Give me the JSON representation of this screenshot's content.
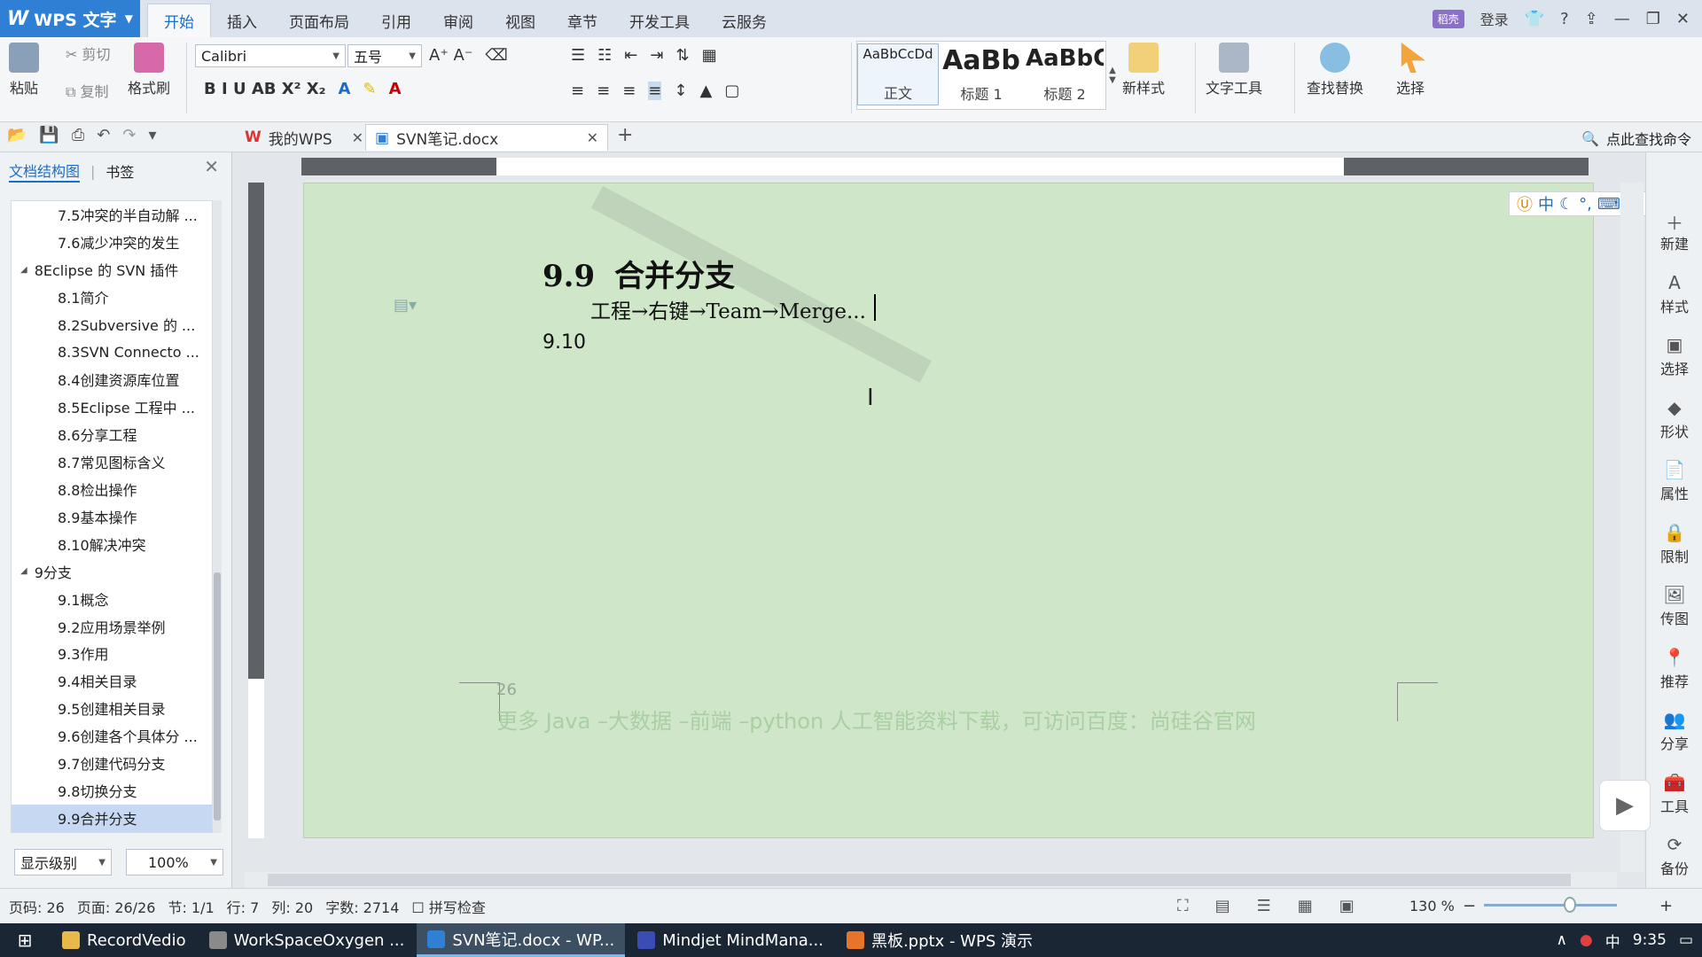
{
  "app": {
    "name": "WPS 文字",
    "logo": "W"
  },
  "ribbon_tabs": [
    "开始",
    "插入",
    "页面布局",
    "引用",
    "审阅",
    "视图",
    "章节",
    "开发工具",
    "云服务"
  ],
  "active_tab": "开始",
  "titlebar_right": {
    "badge": "稻壳",
    "user": "登录",
    "help": "?"
  },
  "ribbon": {
    "paste": "粘贴",
    "cut": "剪切",
    "copy": "复制",
    "format_painter": "格式刷",
    "font_name": "Calibri",
    "font_size": "五号",
    "styles": [
      {
        "sample": "AaBbCcDd",
        "label": "正文"
      },
      {
        "sample": "AaBb",
        "label": "标题 1"
      },
      {
        "sample": "AaBbC",
        "label": "标题 2"
      }
    ],
    "new_style": "新样式",
    "text_tools": "文字工具",
    "find_replace": "查找替换",
    "select": "选择",
    "format_row_top": "A⁺ A⁻",
    "format_row_bottom": "B I U AB X² X₂"
  },
  "doc_tabs": [
    {
      "label": "我的WPS",
      "icon": "wps-icon",
      "active": false
    },
    {
      "label": "SVN笔记.docx",
      "icon": "docx-icon",
      "active": true
    }
  ],
  "search_command": "点此查找命令",
  "nav": {
    "tabs": [
      "文档结构图",
      "书签"
    ],
    "items": [
      {
        "label": "7.5冲突的半自动解 ...",
        "level": 2
      },
      {
        "label": "7.6减少冲突的发生",
        "level": 2
      },
      {
        "label": "8Eclipse 的 SVN 插件",
        "level": 1
      },
      {
        "label": "8.1简介",
        "level": 2
      },
      {
        "label": "8.2Subversive 的 ...",
        "level": 2
      },
      {
        "label": "8.3SVN Connecto ...",
        "level": 2
      },
      {
        "label": "8.4创建资源库位置",
        "level": 2
      },
      {
        "label": "8.5Eclipse 工程中 ...",
        "level": 2
      },
      {
        "label": "8.6分享工程",
        "level": 2
      },
      {
        "label": "8.7常见图标含义",
        "level": 2
      },
      {
        "label": "8.8检出操作",
        "level": 2
      },
      {
        "label": "8.9基本操作",
        "level": 2
      },
      {
        "label": "8.10解决冲突",
        "level": 2
      },
      {
        "label": "9分支",
        "level": 1
      },
      {
        "label": "9.1概念",
        "level": 2
      },
      {
        "label": "9.2应用场景举例",
        "level": 2
      },
      {
        "label": "9.3作用",
        "level": 2
      },
      {
        "label": "9.4相关目录",
        "level": 2
      },
      {
        "label": "9.5创建相关目录",
        "level": 2
      },
      {
        "label": "9.6创建各个具体分 ...",
        "level": 2
      },
      {
        "label": "9.7创建代码分支",
        "level": 2
      },
      {
        "label": "9.8切换分支",
        "level": 2
      },
      {
        "label": "9.9合并分支",
        "level": 2
      }
    ],
    "level_combo": "显示级别",
    "zoom_combo": "100%"
  },
  "document": {
    "heading_number": "9.9",
    "heading_text": "合并分支",
    "body_line": "工程→右键→Team→Merge...",
    "line_2": "9.10",
    "page_number": "26",
    "footer": "更多 Java –大数据 –前端 –python 人工智能资料下载，可访问百度：尚硅谷官网"
  },
  "right_sidebar": [
    "新建",
    "样式",
    "选择",
    "形状",
    "属性",
    "限制",
    "传图",
    "推荐",
    "分享",
    "工具",
    "备份"
  ],
  "status": {
    "page_code": "页码: 26",
    "page": "页面: 26/26",
    "section": "节: 1/1",
    "row": "行: 7",
    "col": "列: 20",
    "word_count": "字数: 2714",
    "spell_check": "拼写检查",
    "zoom": "130 %"
  },
  "taskbar": [
    {
      "label": "RecordVedio",
      "color": "#e8b84a",
      "active": false
    },
    {
      "label": "WorkSpaceOxygen ...",
      "color": "#8a8a8a",
      "active": false
    },
    {
      "label": "SVN笔记.docx - WP...",
      "color": "#2f7fd4",
      "active": true
    },
    {
      "label": "Mindjet MindMana...",
      "color": "#3b4db5",
      "active": false
    },
    {
      "label": "黑板.pptx - WPS 演示",
      "color": "#e8742a",
      "active": false
    }
  ],
  "tray": {
    "ime": "中",
    "time": "9:35"
  }
}
